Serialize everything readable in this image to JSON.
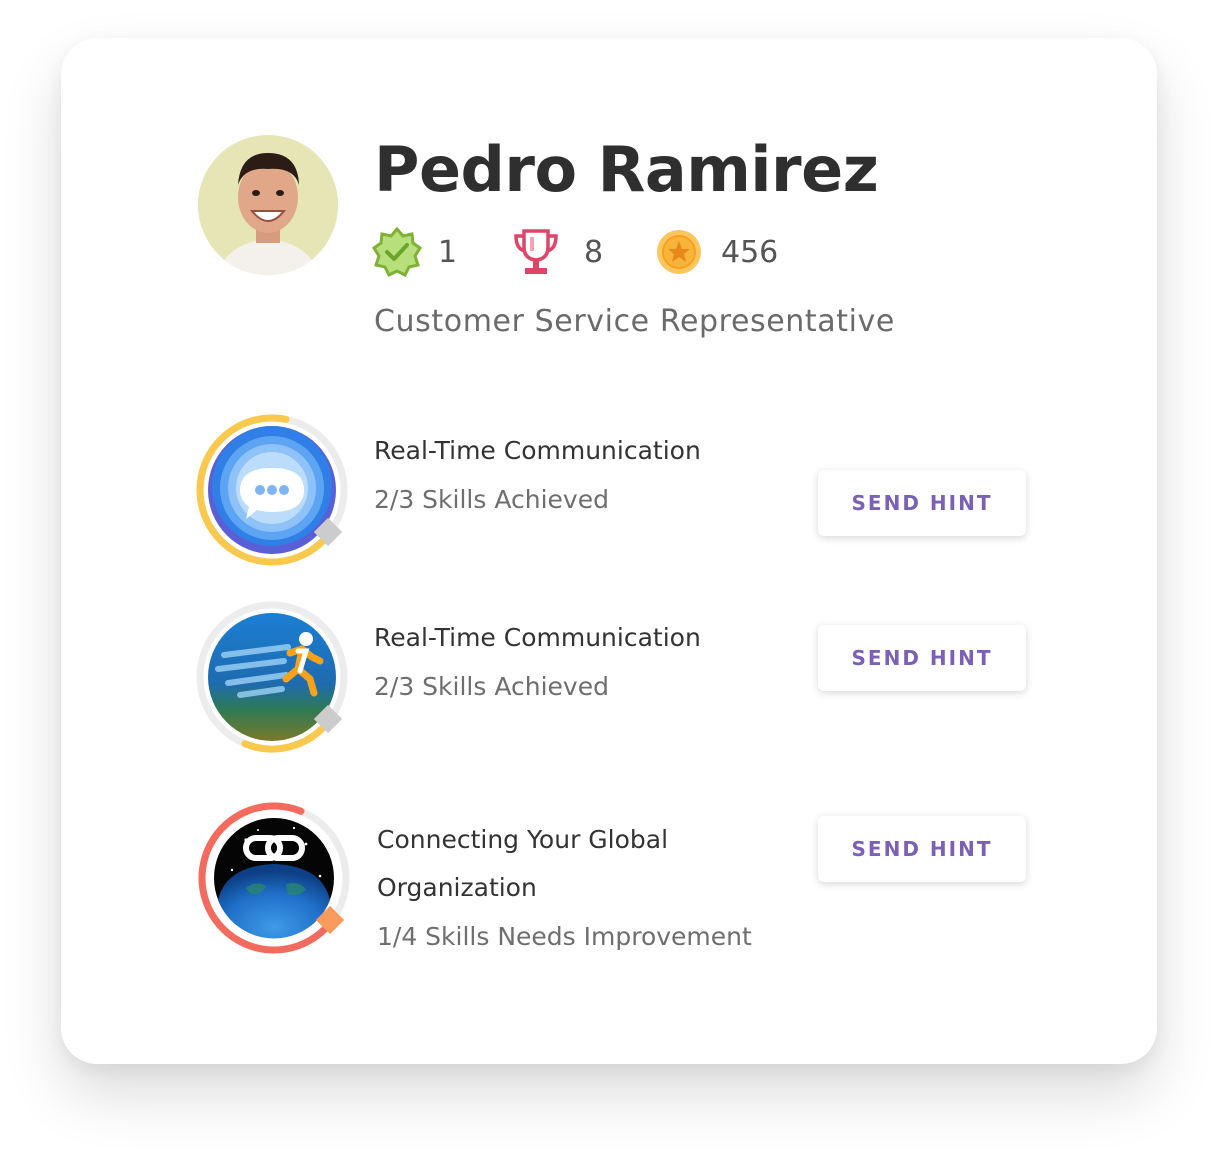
{
  "profile": {
    "name": "Pedro Ramirez",
    "role": "Customer Service Representative",
    "stats": {
      "badges": {
        "icon": "verified-badge-icon",
        "value": "1"
      },
      "trophies": {
        "icon": "trophy-icon",
        "value": "8"
      },
      "points": {
        "icon": "star-coin-icon",
        "value": "456"
      }
    }
  },
  "courses": [
    {
      "title": "Real-Time Communication",
      "status": "2/3 Skills Achieved",
      "button": "SEND HINT",
      "icon": "chat-bubble-icon",
      "progress": 0.67
    },
    {
      "title": "Real-Time Communication",
      "status": "2/3 Skills Achieved",
      "button": "SEND HINT",
      "icon": "running-figure-icon",
      "progress": 0.2
    },
    {
      "title_line1": "Connecting Your Global",
      "title_line2": "Organization",
      "status": "1/4 Skills Needs Improvement",
      "button": "SEND HINT",
      "icon": "globe-link-icon",
      "progress": 0.7
    }
  ],
  "colors": {
    "accent": "#7b61b5",
    "progress_gold": "#f8c94c",
    "progress_red": "#f26b5e",
    "verified_green": "#8cc63f",
    "trophy_red": "#e0476a",
    "coin_orange": "#f7b23b"
  }
}
